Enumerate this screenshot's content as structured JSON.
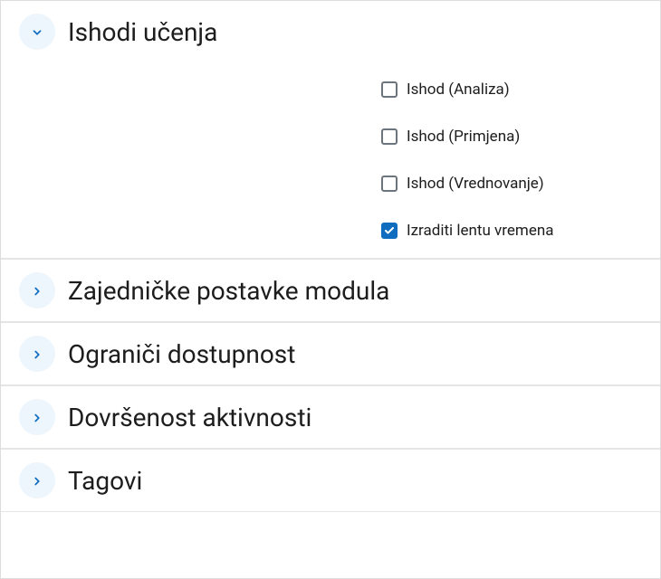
{
  "sections": {
    "outcomes": {
      "title": "Ishodi učenja",
      "expanded": true,
      "items": [
        {
          "label": "Ishod (Analiza)",
          "checked": false
        },
        {
          "label": "Ishod (Primjena)",
          "checked": false
        },
        {
          "label": "Ishod (Vrednovanje)",
          "checked": false
        },
        {
          "label": "Izraditi lentu vremena",
          "checked": true
        }
      ]
    },
    "common_module": {
      "title": "Zajedničke postavke modula",
      "expanded": false
    },
    "restrict_access": {
      "title": "Ograniči dostupnost",
      "expanded": false
    },
    "activity_completion": {
      "title": "Dovršenost aktivnosti",
      "expanded": false
    },
    "tags": {
      "title": "Tagovi",
      "expanded": false
    }
  }
}
